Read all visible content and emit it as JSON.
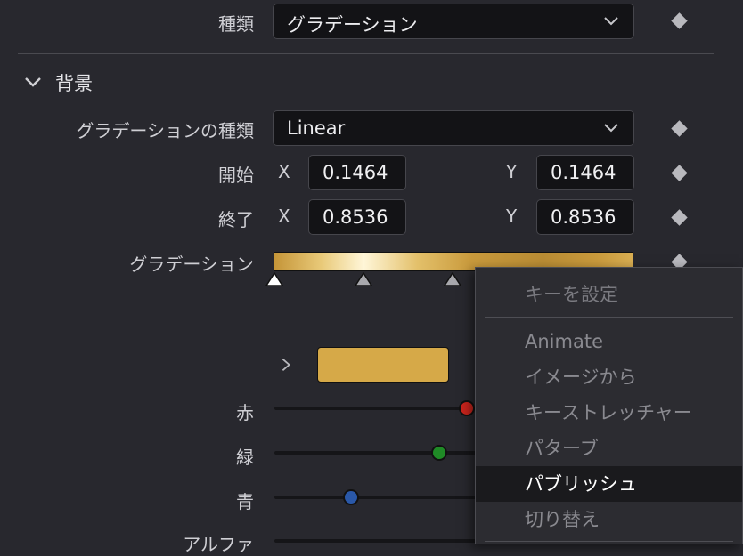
{
  "top": {
    "type_label": "種類",
    "type_value": "グラデーション"
  },
  "background_section": {
    "title": "背景",
    "gradient_type_label": "グラデーションの種類",
    "gradient_type_value": "Linear",
    "start_label": "開始",
    "start_x_axis": "X",
    "start_x": "0.1464",
    "start_y_axis": "Y",
    "start_y": "0.1464",
    "end_label": "終了",
    "end_x_axis": "X",
    "end_x": "0.8536",
    "end_y_axis": "Y",
    "end_y": "0.8536",
    "gradient_label": "グラデーション",
    "swatch_color": "#d6a948",
    "red_label": "赤",
    "green_label": "緑",
    "blue_label": "青",
    "alpha_label": "アルファ",
    "red_value": 0.83,
    "green_value": 0.71,
    "blue_value": 0.33
  },
  "context_menu": {
    "header": "キーを設定",
    "items": [
      {
        "label": "Animate",
        "state": "normal"
      },
      {
        "label": "イメージから",
        "state": "normal"
      },
      {
        "label": "キーストレッチャー",
        "state": "normal"
      },
      {
        "label": "パターブ",
        "state": "normal"
      },
      {
        "label": "パブリッシュ",
        "state": "active"
      },
      {
        "label": "切り替え",
        "state": "normal"
      }
    ]
  },
  "colors": {
    "panel_bg": "#28282e",
    "field_bg": "#131316",
    "red_knob": "#c8241c",
    "green_knob": "#1f8a26",
    "blue_knob": "#2a58a8",
    "gradient_gold": "#c99a3c"
  }
}
